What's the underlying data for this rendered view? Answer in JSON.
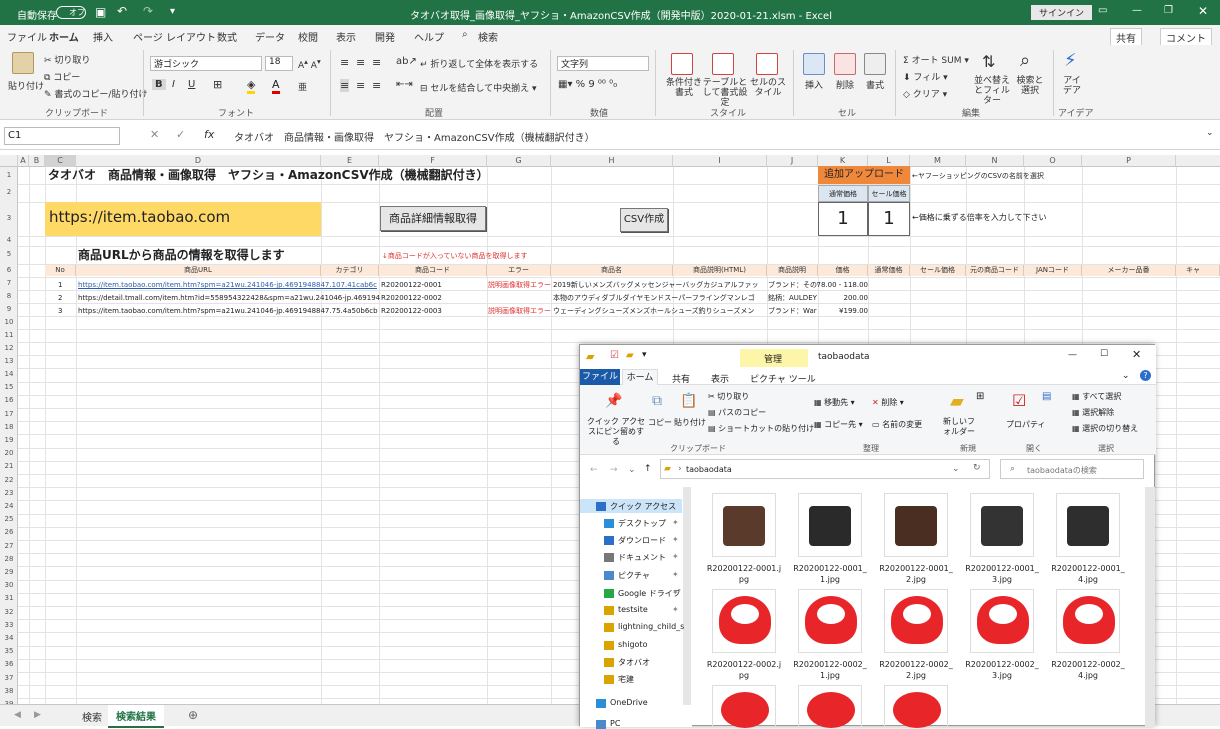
{
  "titlebar": {
    "autosave": "自動保存",
    "autosave_state": "オフ",
    "doc_title": "タオバオ取得_画像取得_ヤフショ・AmazonCSV作成（開発中版）2020-01-21.xlsm  -  Excel",
    "signin": "サインイン"
  },
  "ribbon_tabs": [
    "ファイル",
    "ホーム",
    "挿入",
    "ページ レイアウト",
    "数式",
    "データ",
    "校閲",
    "表示",
    "開発",
    "ヘルプ",
    "検索"
  ],
  "share": "共有",
  "comment": "コメント",
  "ribbon": {
    "paste": "貼り付け",
    "cut": "切り取り",
    "copy": "コピー",
    "format_painter": "書式のコピー/貼り付け",
    "grp_clipboard": "クリップボード",
    "font_name": "游ゴシック",
    "font_size": "18",
    "grp_font": "フォント",
    "bold": "B",
    "italic": "I",
    "underline": "U",
    "wrap": "折り返して全体を表示する",
    "merge": "セルを結合して中央揃え",
    "grp_align": "配置",
    "num_format": "文字列",
    "grp_number": "数値",
    "cond": "条件付き書式",
    "table": "テーブルとして書式設定",
    "cellstyle": "セルのスタイル",
    "grp_style": "スタイル",
    "insert": "挿入",
    "delete": "削除",
    "format": "書式",
    "grp_cell": "セル",
    "autosum": "オート SUM",
    "fill": "フィル",
    "clear": "クリア",
    "sort": "並べ替えとフィルター",
    "find": "検索と選択",
    "grp_edit": "編集",
    "idea": "アイデア",
    "grp_idea": "アイデア"
  },
  "formula": {
    "namebox": "C1",
    "content": "タオバオ　商品情報・画像取得　ヤフショ・AmazonCSV作成（機械翻訳付き）"
  },
  "columns": [
    "A",
    "B",
    "C",
    "D",
    "E",
    "F",
    "G",
    "H",
    "I",
    "J",
    "K",
    "L",
    "M",
    "N",
    "O",
    "P"
  ],
  "sheet": {
    "title": "タオバオ　商品情報・画像取得　ヤフショ・AmazonCSV作成（機械翻訳付き）",
    "url": "https://item.taobao.com",
    "btn_detail": "商品詳細情報取得",
    "btn_csv": "CSV作成",
    "upload": "追加アップロード",
    "upload_note": "←ヤフーショッピングのCSVの名前を選択",
    "normal_price_label": "通常価格",
    "sale_price_label": "セール価格",
    "normal_rate": "1",
    "sale_rate": "1",
    "rate_note": "←価格に乗ずる倍率を入力して下さい",
    "url_note": "商品URLから商品の情報を取得します",
    "code_note": "↓商品コードが入っていない商品を取得します",
    "headers": [
      "No",
      "商品URL",
      "カテゴリ",
      "商品コード",
      "エラー",
      "商品名",
      "商品説明(HTML)",
      "商品説明",
      "価格",
      "通常価格",
      "セール価格",
      "元の商品コード",
      "JANコード",
      "メーカー品番",
      "キャ"
    ],
    "rows": [
      {
        "no": "1",
        "url": "https://item.taobao.com/item.htm?spm=a21wu.241046-jp.4691948847.107.41cab6c",
        "code": "R20200122-0001",
        "error": "説明画像取得エラー",
        "name": "2019新しいメンズバッグメッセンジャーバッグカジュアルファッ",
        "desc": "ブランド：その他",
        "price": "78.00 - 118.00"
      },
      {
        "no": "2",
        "url": "https://detail.tmall.com/item.htm?id=558954322428&spm=a21wu.241046-jp.4691948",
        "code": "R20200122-0002",
        "error": "",
        "name": "本物のアウディダブルダイヤモンドスーパーフライングマンレゴ",
        "desc": "銘柄：AULDEY",
        "price": "200.00"
      },
      {
        "no": "3",
        "url": "https://item.taobao.com/item.htm?spm=a21wu.241046-jp.4691948847.75.4a50b6cb",
        "code": "R20200122-0003",
        "error": "説明画像取得エラー",
        "name": "ウェーディングシューズメンズホールシューズ釣りシューズメン",
        "desc": "ブランド：War",
        "price": "¥199.00"
      }
    ]
  },
  "sheet_tabs": [
    "検索",
    "検索結果"
  ],
  "explorer": {
    "title": "taobaodata",
    "manage": "管理",
    "picture_tools": "ピクチャ ツール",
    "tabs": [
      "ファイル",
      "ホーム",
      "共有",
      "表示"
    ],
    "pin": "クイック アクセスにピン留めする",
    "copy": "コピー",
    "paste": "貼り付け",
    "cut": "切り取り",
    "copy_path": "パスのコピー",
    "paste_shortcut": "ショートカットの貼り付け",
    "grp_clip": "クリップボード",
    "move": "移動先",
    "copyto": "コピー先",
    "delete": "削除",
    "rename": "名前の変更",
    "grp_org": "整理",
    "newfolder": "新しいフォルダー",
    "grp_new": "新規",
    "props": "プロパティ",
    "grp_open": "開く",
    "selall": "すべて選択",
    "selnone": "選択解除",
    "selinv": "選択の切り替え",
    "grp_sel": "選択",
    "path": "taobaodata",
    "search_ph": "taobaodataの検索",
    "nav": [
      "クイック アクセス",
      "デスクトップ",
      "ダウンロード",
      "ドキュメント",
      "ピクチャ",
      "Google ドライブ",
      "testsite",
      "lightning_child_s",
      "shigoto",
      "タオバオ",
      "宅建",
      "OneDrive",
      "PC"
    ],
    "files": [
      "R20200122-0001.jpg",
      "R20200122-0001_1.jpg",
      "R20200122-0001_2.jpg",
      "R20200122-0001_3.jpg",
      "R20200122-0001_4.jpg",
      "R20200122-0002.jpg",
      "R20200122-0002_1.jpg",
      "R20200122-0002_2.jpg",
      "R20200122-0002_3.jpg",
      "R20200122-0002_4.jpg"
    ]
  }
}
